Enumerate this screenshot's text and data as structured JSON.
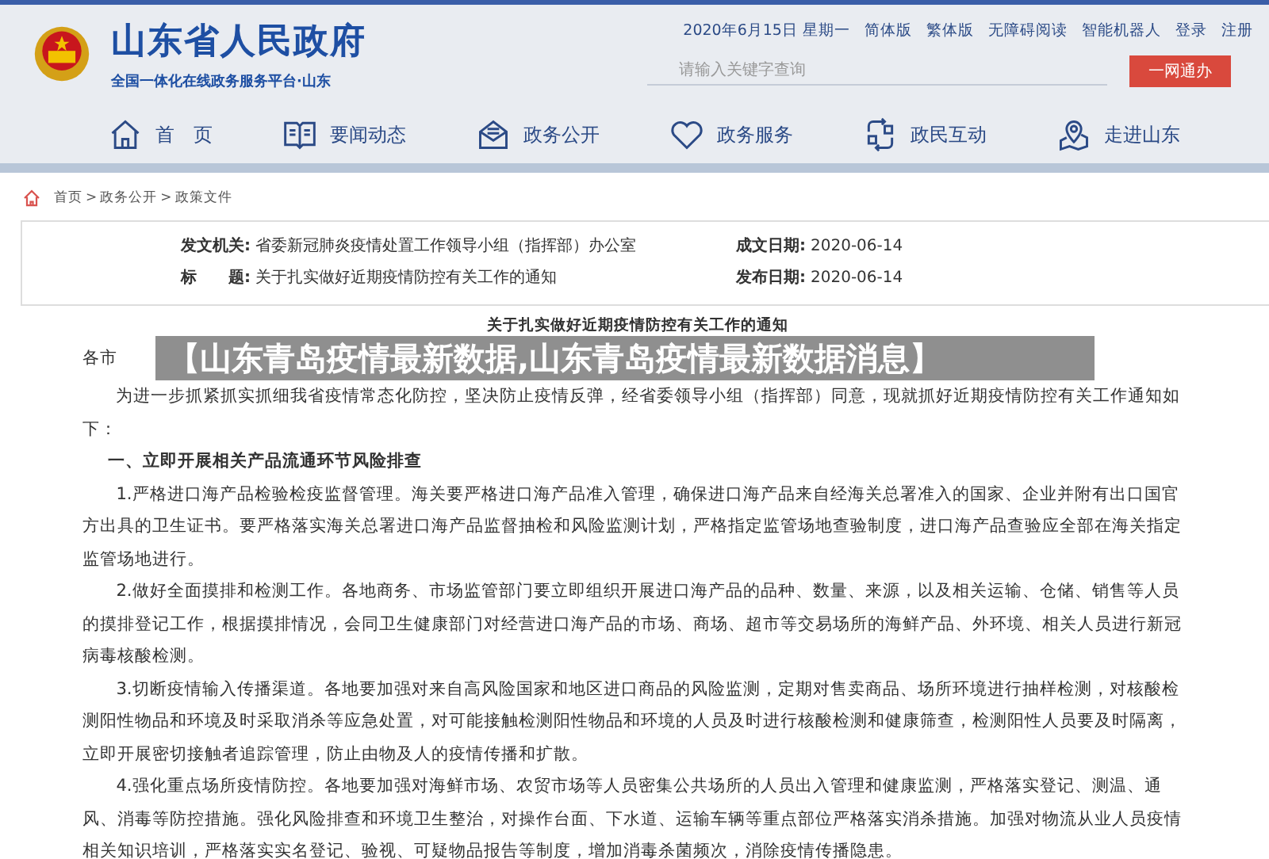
{
  "header": {
    "site_title": "山东省人民政府",
    "subtitle": "全国一体化在线政务服务平台·山东",
    "date": "2020年6月15日 星期一",
    "links": [
      "简体版",
      "繁体版",
      "无障碍阅读",
      "智能机器人",
      "登录",
      "注册"
    ],
    "search": {
      "placeholder": "请输入关键字查询"
    },
    "service_button": "一网通办"
  },
  "nav": [
    {
      "label": "首　页",
      "kind": "home"
    },
    {
      "label": "要闻动态",
      "kind": "book"
    },
    {
      "label": "政务公开",
      "kind": "mail"
    },
    {
      "label": "政务服务",
      "kind": "heart"
    },
    {
      "label": "政民互动",
      "kind": "cycle"
    },
    {
      "label": "走进山东",
      "kind": "pin"
    }
  ],
  "breadcrumb": [
    {
      "label": "首页",
      "separator": ">"
    },
    {
      "label": "政务公开",
      "separator": ">"
    },
    {
      "label": "政策文件"
    }
  ],
  "info": [
    {
      "label": "发文机关:",
      "value": "省委新冠肺炎疫情处置工作领导小组（指挥部）办公室"
    },
    {
      "label": "成文日期:",
      "value": "2020-06-14"
    },
    {
      "label": "标　　题:",
      "value": "关于扎实做好近期疫情防控有关工作的通知"
    },
    {
      "label": "发布日期:",
      "value": "2020-06-14"
    }
  ],
  "article": {
    "title": "关于扎实做好近期疫情防控有关工作的通知",
    "salutation": "各市",
    "paragraphs": [
      {
        "kind": "text",
        "text": "为进一步抓紧抓实抓细我省疫情常态化防控，坚决防止疫情反弹，经省委领导小组（指挥部）同意，现就抓好近期疫情防控有关工作通知如下："
      },
      {
        "kind": "heading",
        "text": "一、立即开展相关产品流通环节风险排查"
      },
      {
        "kind": "text",
        "text": "1.严格进口海产品检验检疫监督管理。海关要严格进口海产品准入管理，确保进口海产品来自经海关总署准入的国家、企业并附有出口国官方出具的卫生证书。要严格落实海关总署进口海产品监督抽检和风险监测计划，严格指定监管场地查验制度，进口海产品查验应全部在海关指定监管场地进行。"
      },
      {
        "kind": "text",
        "text": "2.做好全面摸排和检测工作。各地商务、市场监管部门要立即组织开展进口海产品的品种、数量、来源，以及相关运输、仓储、销售等人员的摸排登记工作，根据摸排情况，会同卫生健康部门对经营进口海产品的市场、商场、超市等交易场所的海鲜产品、外环境、相关人员进行新冠病毒核酸检测。"
      },
      {
        "kind": "text",
        "text": "3.切断疫情输入传播渠道。各地要加强对来自高风险国家和地区进口商品的风险监测，定期对售卖商品、场所环境进行抽样检测，对核酸检测阳性物品和环境及时采取消杀等应急处置，对可能接触检测阳性物品和环境的人员及时进行核酸检测和健康筛查，检测阳性人员要及时隔离，立即开展密切接触者追踪管理，防止由物及人的疫情传播和扩散。"
      },
      {
        "kind": "text",
        "text": "4.强化重点场所疫情防控。各地要加强对海鲜市场、农贸市场等人员密集公共场所的人员出入管理和健康监测，严格落实登记、测温、通风、消毒等防控措施。强化风险排查和环境卫生整治，对操作台面、下水道、运输车辆等重点部位严格落实消杀措施。加强对物流从业人员疫情相关知识培训，严格落实实名登记、验视、可疑物品报告等制度，增加消毒杀菌频次，消除疫情传播隐患。"
      }
    ]
  },
  "banner": "【山东青岛疫情最新数据,山东青岛疫情最新数据消息】"
}
